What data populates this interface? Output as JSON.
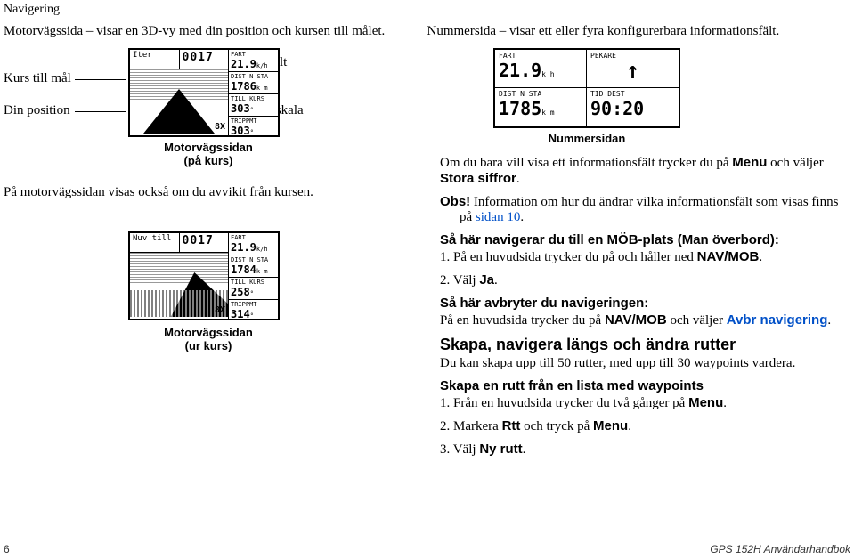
{
  "header": {
    "title": "Navigering"
  },
  "intro": {
    "left": "Motorvägssida – visar en 3D-vy med din position och kursen till målet.",
    "right": "Nummersida – visar ett eller fyra konfigurerbara informationsfält."
  },
  "labels": {
    "kurs": "Kurs till mål",
    "din": "Din position",
    "datafalt": "Datafält",
    "zoom": "Zoomskala"
  },
  "screen1": {
    "tl_label": "Iter",
    "tl_value": "0017",
    "side": [
      {
        "lbl": "FART",
        "val": "21.9",
        "unit": "k/h"
      },
      {
        "lbl": "DIST N STA",
        "val": "1786",
        "unit": "k m"
      },
      {
        "lbl": "TILL KURS",
        "val": "303",
        "unit": "°"
      },
      {
        "lbl": "TRIPPMT",
        "val": "303",
        "unit": "°"
      }
    ],
    "zoom": "8X"
  },
  "caption1a": "Motorvägssidan",
  "caption1b": "(på kurs)",
  "below_text": "På motorvägssidan visas också om du avvikit från kursen.",
  "screen2": {
    "tl_label": "Nuv till",
    "tl_value": "0017",
    "side": [
      {
        "lbl": "FART",
        "val": "21.9",
        "unit": "k/h"
      },
      {
        "lbl": "DIST N STA",
        "val": "1784",
        "unit": "k m"
      },
      {
        "lbl": "TILL KURS",
        "val": "258",
        "unit": "°"
      },
      {
        "lbl": "TRIPPMT",
        "val": "314",
        "unit": "°"
      }
    ],
    "zoom": "8X"
  },
  "caption2a": "Motorvägssidan",
  "caption2b": "(ur kurs)",
  "numscreen": {
    "cells": [
      {
        "lbl": "FART",
        "val": "21.9",
        "unit": "k h"
      },
      {
        "lbl": "PEKARE",
        "arrow": "↑"
      },
      {
        "lbl": "DIST N STA",
        "val": "1785",
        "unit": "k m"
      },
      {
        "lbl": "TID DEST",
        "val": "90:20",
        "unit": ""
      }
    ]
  },
  "numcaption": "Nummersidan",
  "rtext": {
    "p1": "Om du bara vill visa ett informationsfält trycker du på ",
    "p1_menu": "Menu",
    "p1_mid": " och väljer ",
    "p1_stora": "Stora siffror",
    "p1_end": ".",
    "obs_lbl": "Obs!",
    "obs_txt": " Information om hur du ändrar vilka informationsfält som visas finns på ",
    "obs_link": "sidan 10",
    "obs_end": ".",
    "h_mob": "Så här navigerar du till en MÖB-plats (Man överbord):",
    "mob1": "1.  På en huvudsida trycker du på och håller ned ",
    "navmob": "NAV/MOB",
    "mob1_end": ".",
    "mob2": "2.  Välj ",
    "ja": "Ja",
    "mob2_end": ".",
    "h_avbr": "Så här avbryter du navigeringen:",
    "avbr_txt": "På en huvudsida trycker du på ",
    "avbr_mid": " och väljer ",
    "avbr_link": "Avbr navigering",
    "avbr_end": ".",
    "h2": "Skapa, navigera längs och ändra rutter",
    "h2_sub": "Du kan skapa upp till 50 rutter, med upp till 30 waypoints vardera.",
    "h3": "Skapa en rutt från en lista med waypoints",
    "r1": "1.  Från en huvudsida trycker du två gånger på ",
    "menu": "Menu",
    "r1_end": ".",
    "r2": "2.  Markera ",
    "rtt": "Rtt",
    "r2_mid": " och tryck på ",
    "r2_end": ".",
    "r3": "3.  Välj ",
    "nyrutt": "Ny rutt",
    "r3_end": "."
  },
  "footer": {
    "page": "6",
    "doc": "GPS 152H Användarhandbok"
  }
}
